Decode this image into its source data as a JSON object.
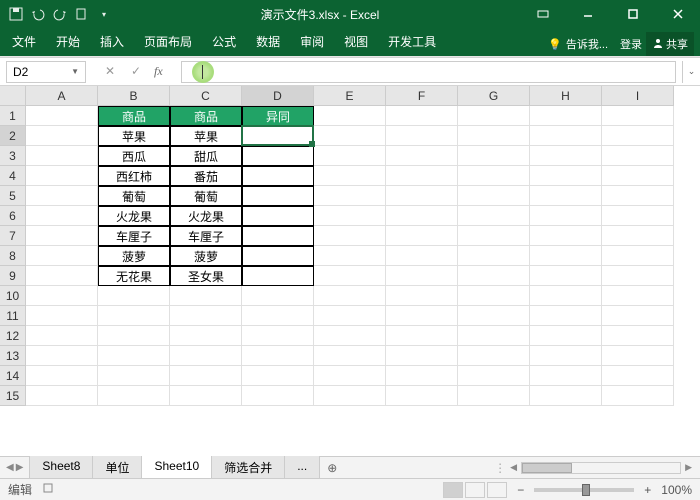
{
  "title": "演示文件3.xlsx - Excel",
  "qat_icons": [
    "save-icon",
    "undo-icon",
    "redo-icon",
    "refresh-icon",
    "touch-icon",
    "dropdown-icon"
  ],
  "ribbon": {
    "tabs": [
      "文件",
      "开始",
      "插入",
      "页面布局",
      "公式",
      "数据",
      "审阅",
      "视图",
      "开发工具"
    ],
    "tell_me": "告诉我...",
    "login": "登录",
    "share": "共享"
  },
  "namebox": "D2",
  "formula": "",
  "columns": [
    "A",
    "B",
    "C",
    "D",
    "E",
    "F",
    "G",
    "H",
    "I"
  ],
  "active_col_index": 3,
  "rows": [
    1,
    2,
    3,
    4,
    5,
    6,
    7,
    8,
    9,
    10,
    11,
    12,
    13,
    14,
    15
  ],
  "active_row_index": 1,
  "header_cells": {
    "b": "商品",
    "c": "商品",
    "d": "异同"
  },
  "data_rows": [
    {
      "b": "苹果",
      "c": "苹果"
    },
    {
      "b": "西瓜",
      "c": "甜瓜"
    },
    {
      "b": "西红柿",
      "c": "番茄"
    },
    {
      "b": "葡萄",
      "c": "葡萄"
    },
    {
      "b": "火龙果",
      "c": "火龙果"
    },
    {
      "b": "车厘子",
      "c": "车厘子"
    },
    {
      "b": "菠萝",
      "c": "菠萝"
    },
    {
      "b": "无花果",
      "c": "圣女果"
    }
  ],
  "sheet_tabs": {
    "items": [
      "Sheet8",
      "单位",
      "Sheet10",
      "筛选合并"
    ],
    "active_index": 2,
    "overflow": "..."
  },
  "statusbar": {
    "mode": "编辑",
    "zoom": "100%",
    "zoom_minus": "−",
    "zoom_plus": "+"
  }
}
